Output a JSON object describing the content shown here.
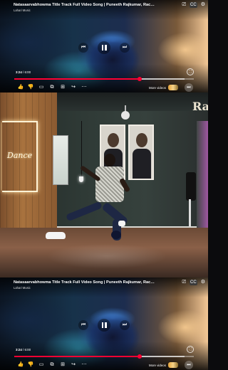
{
  "player_top": {
    "title": "Natasaarvabhowma Title Track Full Video Song | Puneeth Rajkumar, Rachita Ram",
    "channel": "Lahari Music",
    "time_current": "3:24",
    "time_total": "6:00",
    "time_separator": " / ",
    "progress_played": 0.7,
    "progress_buffered": 0.95,
    "more_videos_label": "More videos"
  },
  "player_bottom": {
    "title": "Natasaarvabhowma Title Track Full Video Song | Puneeth Rajkumar, Rachita Ram",
    "channel": "Lahari Music",
    "time_current": "3:24",
    "time_total": "6:00",
    "time_separator": " / ",
    "progress_played": 0.7,
    "progress_buffered": 0.95,
    "more_videos_label": "More videos"
  },
  "studio": {
    "logo_text": "Dance",
    "wall_letters": "Ra"
  },
  "icons": {
    "cast": "cast-icon",
    "captions": "captions-icon",
    "settings": "gear-icon",
    "previous": "previous-icon",
    "pause": "pause-icon",
    "next": "next-icon",
    "fullscreen": "fullscreen-icon",
    "like": "thumbs-up-icon",
    "dislike": "thumbs-down-icon",
    "comment": "comment-icon",
    "remix": "remix-icon",
    "save": "save-icon",
    "share": "share-icon",
    "more": "more-icon",
    "skip": "skip-icon"
  },
  "colors": {
    "progress_played": "#ff0033",
    "accent_neon": "#fff3d6"
  }
}
